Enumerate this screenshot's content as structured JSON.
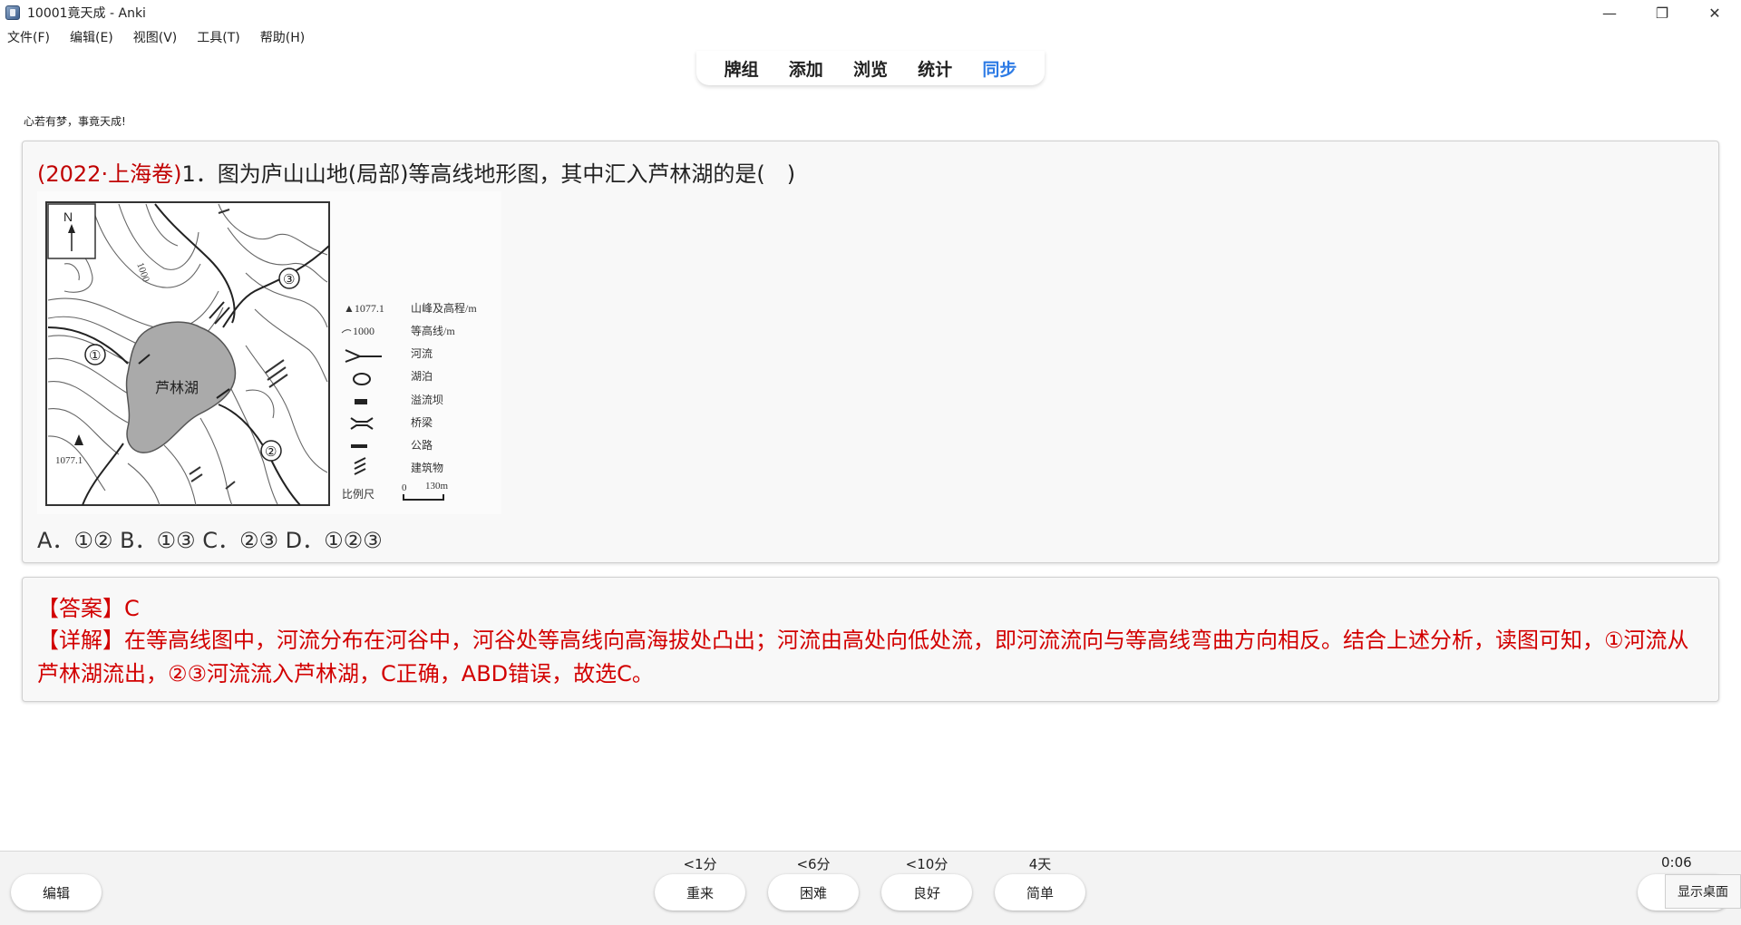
{
  "window": {
    "title": "10001竟天成 - Anki",
    "controls": {
      "minimize": "—",
      "maximize": "❐",
      "close": "✕"
    }
  },
  "menu": [
    "文件(F)",
    "编辑(E)",
    "视图(V)",
    "工具(T)",
    "帮助(H)"
  ],
  "toolbar": {
    "items": [
      {
        "label": "牌组",
        "active": false
      },
      {
        "label": "添加",
        "active": false
      },
      {
        "label": "浏览",
        "active": false
      },
      {
        "label": "统计",
        "active": false
      },
      {
        "label": "同步",
        "active": true
      }
    ],
    "accent": "#2d7be5"
  },
  "card": {
    "motto": "心若有梦，事竟天成!",
    "question_source": "(2022·上海卷)",
    "question_text": "1．图为庐山山地(局部)等高线地形图，其中汇入芦林湖的是(　)",
    "choices": "A．①② B．①③ C．②③ D．①②③",
    "map": {
      "north": "N",
      "lake": "芦林湖",
      "contour_label": "1000",
      "peak_label": "1077.1",
      "markers": [
        "①",
        "②",
        "③"
      ],
      "legend": [
        {
          "symbol": "▲1077.1",
          "text": "山峰及高程/m"
        },
        {
          "symbol": "1000",
          "text": "等高线/m"
        },
        {
          "symbol": "",
          "text": "河流"
        },
        {
          "symbol": "",
          "text": "湖泊"
        },
        {
          "symbol": "",
          "text": "溢流坝"
        },
        {
          "symbol": "",
          "text": "桥梁"
        },
        {
          "symbol": "",
          "text": "公路"
        },
        {
          "symbol": "",
          "text": "建筑物"
        }
      ],
      "scale_label": "比例尺",
      "scale_zero": "0",
      "scale_end": "130m"
    },
    "answer": "【答案】C",
    "explanation": "【详解】在等高线图中，河流分布在河谷中，河谷处等高线向高海拔处凸出；河流由高处向低处流，即河流流向与等高线弯曲方向相反。结合上述分析，读图可知，①河流从芦林湖流出，②③河流流入芦林湖，C正确，ABD错误，故选C。",
    "answer_color": "#d20000",
    "source_color": "#c00000"
  },
  "bottom": {
    "edit_label": "编辑",
    "buttons": [
      {
        "label": "重来",
        "interval": "<1分"
      },
      {
        "label": "困难",
        "interval": "<6分"
      },
      {
        "label": "良好",
        "interval": "<10分"
      },
      {
        "label": "简单",
        "interval": "4天"
      }
    ],
    "timer": "0:06",
    "tooltip": "显示桌面"
  }
}
